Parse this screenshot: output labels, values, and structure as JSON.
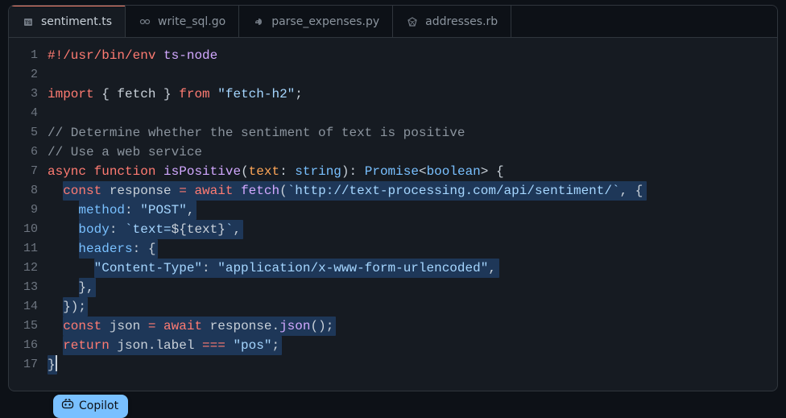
{
  "tabs": [
    {
      "label": "sentiment.ts",
      "icon": "ts",
      "active": true
    },
    {
      "label": "write_sql.go",
      "icon": "go",
      "active": false
    },
    {
      "label": "parse_expenses.py",
      "icon": "py",
      "active": false
    },
    {
      "label": "addresses.rb",
      "icon": "rb",
      "active": false
    }
  ],
  "code": {
    "highlight_start": 8,
    "highlight_end": 17,
    "lines": [
      [
        {
          "t": "#!/usr/bin/env",
          "c": "c-shebang"
        },
        {
          "t": " ",
          "c": ""
        },
        {
          "t": "ts-node",
          "c": "c-shebang2"
        }
      ],
      [],
      [
        {
          "t": "import",
          "c": "c-keyword"
        },
        {
          "t": " { ",
          "c": "c-punct"
        },
        {
          "t": "fetch",
          "c": "c-var"
        },
        {
          "t": " } ",
          "c": "c-punct"
        },
        {
          "t": "from",
          "c": "c-keyword"
        },
        {
          "t": " ",
          "c": ""
        },
        {
          "t": "\"fetch-h2\"",
          "c": "c-string"
        },
        {
          "t": ";",
          "c": "c-punct"
        }
      ],
      [],
      [
        {
          "t": "// Determine whether the sentiment of text is positive",
          "c": "c-comment"
        }
      ],
      [
        {
          "t": "// Use a web service",
          "c": "c-comment"
        }
      ],
      [
        {
          "t": "async",
          "c": "c-keyword"
        },
        {
          "t": " ",
          "c": ""
        },
        {
          "t": "function",
          "c": "c-keyword"
        },
        {
          "t": " ",
          "c": ""
        },
        {
          "t": "isPositive",
          "c": "c-function"
        },
        {
          "t": "(",
          "c": "c-punct"
        },
        {
          "t": "text",
          "c": "c-param"
        },
        {
          "t": ":",
          "c": "c-punct"
        },
        {
          "t": " ",
          "c": ""
        },
        {
          "t": "string",
          "c": "c-type"
        },
        {
          "t": ")",
          "c": "c-punct"
        },
        {
          "t": ":",
          "c": "c-punct"
        },
        {
          "t": " ",
          "c": ""
        },
        {
          "t": "Promise",
          "c": "c-type"
        },
        {
          "t": "<",
          "c": "c-punct"
        },
        {
          "t": "boolean",
          "c": "c-type"
        },
        {
          "t": ">",
          "c": "c-punct"
        },
        {
          "t": " {",
          "c": "c-punct"
        }
      ],
      [
        {
          "t": "  ",
          "c": ""
        },
        {
          "t": "const",
          "c": "c-keyword"
        },
        {
          "t": " response ",
          "c": "c-var"
        },
        {
          "t": "=",
          "c": "c-op"
        },
        {
          "t": " ",
          "c": ""
        },
        {
          "t": "await",
          "c": "c-keyword"
        },
        {
          "t": " ",
          "c": ""
        },
        {
          "t": "fetch",
          "c": "c-function"
        },
        {
          "t": "(",
          "c": "c-punct"
        },
        {
          "t": "`http://text-processing.com/api/sentiment/`",
          "c": "c-string"
        },
        {
          "t": ", {",
          "c": "c-punct"
        }
      ],
      [
        {
          "t": "    ",
          "c": ""
        },
        {
          "t": "method",
          "c": "c-prop"
        },
        {
          "t": ":",
          "c": "c-punct"
        },
        {
          "t": " ",
          "c": ""
        },
        {
          "t": "\"POST\"",
          "c": "c-string"
        },
        {
          "t": ",",
          "c": "c-punct"
        }
      ],
      [
        {
          "t": "    ",
          "c": ""
        },
        {
          "t": "body",
          "c": "c-prop"
        },
        {
          "t": ":",
          "c": "c-punct"
        },
        {
          "t": " ",
          "c": ""
        },
        {
          "t": "`text=",
          "c": "c-string"
        },
        {
          "t": "${",
          "c": "c-punct"
        },
        {
          "t": "text",
          "c": "c-var"
        },
        {
          "t": "}",
          "c": "c-punct"
        },
        {
          "t": "`",
          "c": "c-string"
        },
        {
          "t": ",",
          "c": "c-punct"
        }
      ],
      [
        {
          "t": "    ",
          "c": ""
        },
        {
          "t": "headers",
          "c": "c-prop"
        },
        {
          "t": ":",
          "c": "c-punct"
        },
        {
          "t": " {",
          "c": "c-punct"
        }
      ],
      [
        {
          "t": "      ",
          "c": ""
        },
        {
          "t": "\"Content-Type\"",
          "c": "c-string"
        },
        {
          "t": ":",
          "c": "c-punct"
        },
        {
          "t": " ",
          "c": ""
        },
        {
          "t": "\"application/x-www-form-urlencoded\"",
          "c": "c-string"
        },
        {
          "t": ",",
          "c": "c-punct"
        }
      ],
      [
        {
          "t": "    },",
          "c": "c-punct"
        }
      ],
      [
        {
          "t": "  });",
          "c": "c-punct"
        }
      ],
      [
        {
          "t": "  ",
          "c": ""
        },
        {
          "t": "const",
          "c": "c-keyword"
        },
        {
          "t": " json ",
          "c": "c-var"
        },
        {
          "t": "=",
          "c": "c-op"
        },
        {
          "t": " ",
          "c": ""
        },
        {
          "t": "await",
          "c": "c-keyword"
        },
        {
          "t": " response.",
          "c": "c-var"
        },
        {
          "t": "json",
          "c": "c-function"
        },
        {
          "t": "();",
          "c": "c-punct"
        }
      ],
      [
        {
          "t": "  ",
          "c": ""
        },
        {
          "t": "return",
          "c": "c-keyword"
        },
        {
          "t": " json.label ",
          "c": "c-var"
        },
        {
          "t": "===",
          "c": "c-op"
        },
        {
          "t": " ",
          "c": ""
        },
        {
          "t": "\"pos\"",
          "c": "c-string"
        },
        {
          "t": ";",
          "c": "c-punct"
        }
      ],
      [
        {
          "t": "}",
          "c": "c-punct"
        }
      ]
    ]
  },
  "copilot": {
    "label": "Copilot"
  }
}
